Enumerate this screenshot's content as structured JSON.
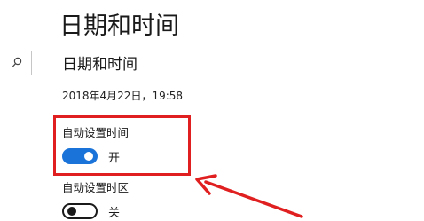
{
  "page_title": "日期和时间",
  "section_title": "日期和时间",
  "current_datetime": "2018年4月22日，19:58",
  "settings": [
    {
      "label": "自动设置时间",
      "state_text": "开",
      "on": true
    },
    {
      "label": "自动设置时区",
      "state_text": "关",
      "on": false
    }
  ],
  "colors": {
    "toggle_on": "#1a73d9",
    "annotation": "#e02020"
  },
  "icons": {
    "search": "search-icon"
  }
}
